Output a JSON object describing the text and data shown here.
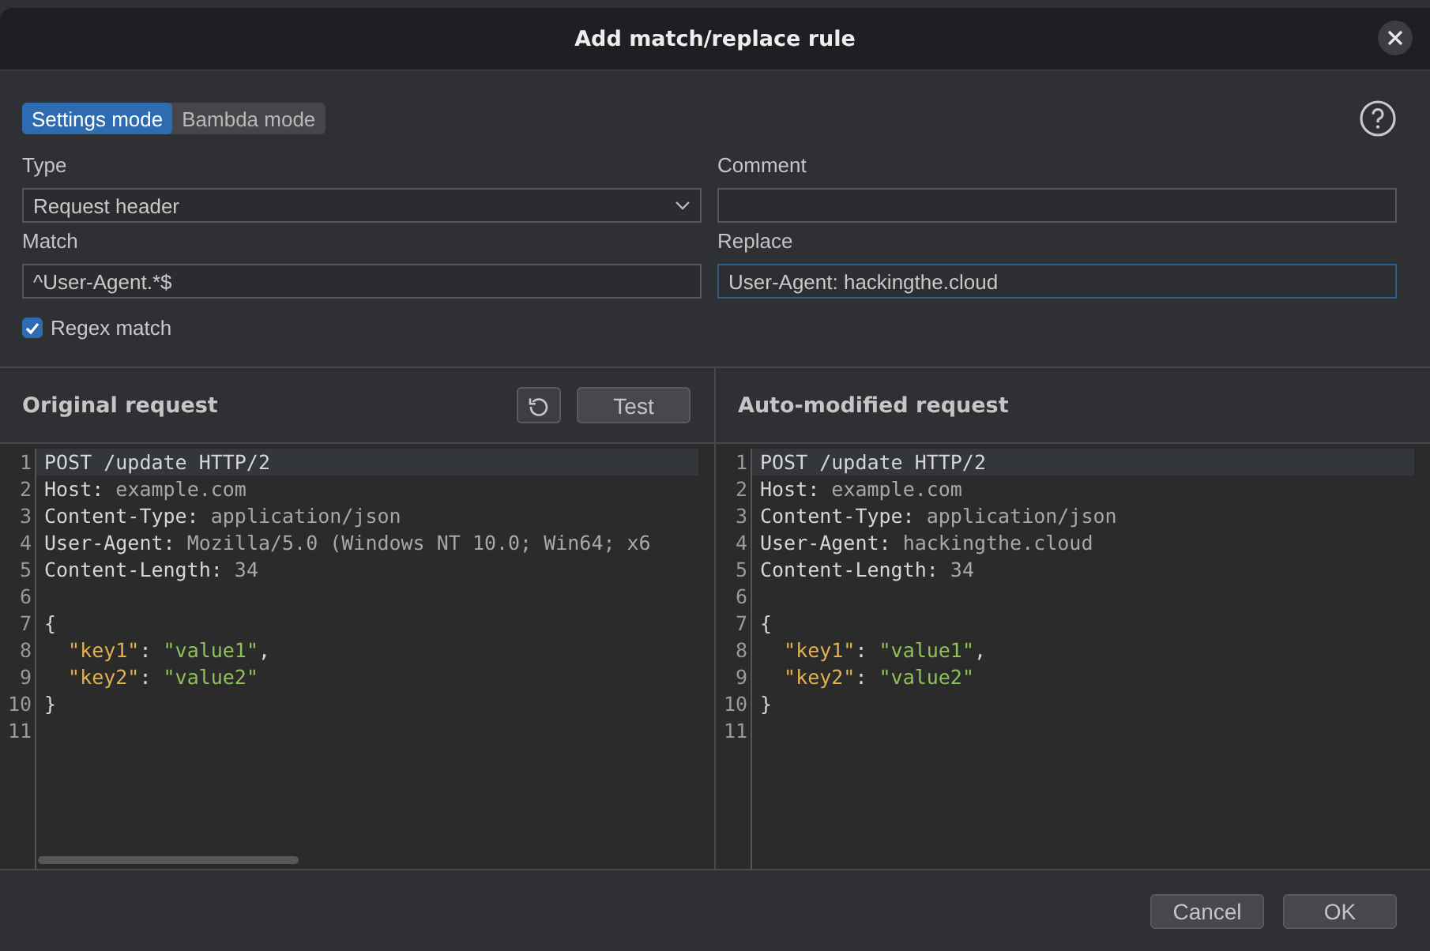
{
  "dialog": {
    "title": "Add match/replace rule"
  },
  "mode_tabs": [
    {
      "label": "Settings mode",
      "selected": true
    },
    {
      "label": "Bambda mode",
      "selected": false
    }
  ],
  "form": {
    "type": {
      "label": "Type",
      "value": "Request header"
    },
    "comment": {
      "label": "Comment"
    },
    "match": {
      "label": "Match",
      "value": "^User-Agent.*$",
      "focused": false
    },
    "replace": {
      "label": "Replace",
      "value": "User-Agent: hackingthe.cloud",
      "focused": true
    },
    "regex": {
      "label": "Regex match",
      "checked": true
    }
  },
  "panels": [
    {
      "title": "Original request",
      "buttons": [
        "Test"
      ],
      "scrollbar": true,
      "lines": [
        {
          "number": "1",
          "tokens": [
            {
              "kind": "name",
              "text": "POST /update HTTP/2"
            }
          ]
        },
        {
          "number": "2",
          "tokens": [
            {
              "kind": "name",
              "text": "Host:"
            },
            {
              "kind": "value",
              "text": " example.com"
            }
          ]
        },
        {
          "number": "3",
          "tokens": [
            {
              "kind": "name",
              "text": "Content-Type:"
            },
            {
              "kind": "value",
              "text": " application/json"
            }
          ]
        },
        {
          "number": "4",
          "tokens": [
            {
              "kind": "name",
              "text": "User-Agent:"
            },
            {
              "kind": "value",
              "text": " Mozilla/5.0 (Windows NT 10.0; Win64; x6"
            }
          ]
        },
        {
          "number": "5",
          "tokens": [
            {
              "kind": "name",
              "text": "Content-Length:"
            },
            {
              "kind": "value",
              "text": " 34"
            }
          ]
        },
        {
          "number": "6"
        },
        {
          "number": "7",
          "tokens": [
            {
              "kind": "punct",
              "text": "{"
            }
          ]
        },
        {
          "number": "8",
          "tokens": [
            {
              "kind": "key",
              "text": "  \"key1\""
            },
            {
              "kind": "punct",
              "text": ": "
            },
            {
              "kind": "string",
              "text": "\"value1\""
            },
            {
              "kind": "punct",
              "text": ","
            }
          ]
        },
        {
          "number": "9",
          "tokens": [
            {
              "kind": "key",
              "text": "  \"key2\""
            },
            {
              "kind": "punct",
              "text": ": "
            },
            {
              "kind": "string",
              "text": "\"value2\""
            }
          ]
        },
        {
          "number": "10",
          "tokens": [
            {
              "kind": "punct",
              "text": "}"
            }
          ]
        },
        {
          "number": "11"
        }
      ]
    },
    {
      "title": "Auto-modified request",
      "scrollbar": false,
      "lines": [
        {
          "number": "1",
          "tokens": [
            {
              "kind": "name",
              "text": "POST /update HTTP/2"
            }
          ]
        },
        {
          "number": "2",
          "tokens": [
            {
              "kind": "name",
              "text": "Host:"
            },
            {
              "kind": "value",
              "text": " example.com"
            }
          ]
        },
        {
          "number": "3",
          "tokens": [
            {
              "kind": "name",
              "text": "Content-Type:"
            },
            {
              "kind": "value",
              "text": " application/json"
            }
          ]
        },
        {
          "number": "4",
          "tokens": [
            {
              "kind": "name",
              "text": "User-Agent:"
            },
            {
              "kind": "value",
              "text": " hackingthe.cloud"
            }
          ]
        },
        {
          "number": "5",
          "tokens": [
            {
              "kind": "name",
              "text": "Content-Length:"
            },
            {
              "kind": "value",
              "text": " 34"
            }
          ]
        },
        {
          "number": "6"
        },
        {
          "number": "7",
          "tokens": [
            {
              "kind": "punct",
              "text": "{"
            }
          ]
        },
        {
          "number": "8",
          "tokens": [
            {
              "kind": "key",
              "text": "  \"key1\""
            },
            {
              "kind": "punct",
              "text": ": "
            },
            {
              "kind": "string",
              "text": "\"value1\""
            },
            {
              "kind": "punct",
              "text": ","
            }
          ]
        },
        {
          "number": "9",
          "tokens": [
            {
              "kind": "key",
              "text": "  \"key2\""
            },
            {
              "kind": "punct",
              "text": ": "
            },
            {
              "kind": "string",
              "text": "\"value2\""
            }
          ]
        },
        {
          "number": "10",
          "tokens": [
            {
              "kind": "punct",
              "text": "}"
            }
          ]
        },
        {
          "number": "11"
        }
      ]
    }
  ],
  "footer_buttons": [
    "Cancel",
    "OK"
  ]
}
